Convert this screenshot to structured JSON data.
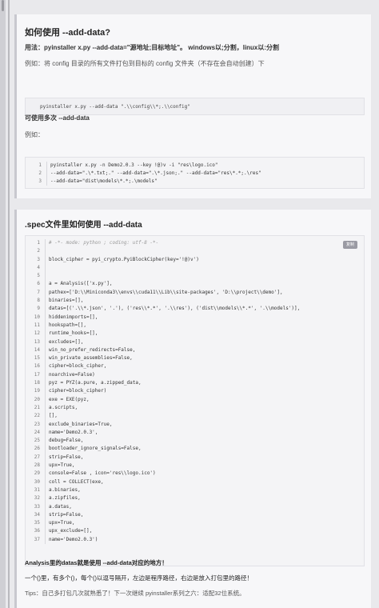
{
  "section1": {
    "title": "如何使用 --add-data?",
    "usage": "用法：pyinstaller x.py --add-data=\"源地址;目标地址\"。 windows以;分割，linux以:分割",
    "example_label": "例如：将 config 目录的所有文件打包到目标的 config 文件夹（不存在会自动创建）下",
    "single_code": "pyinstaller x.py --add-data \".\\\\config\\\\*;.\\\\config\"",
    "multi_label": "可使用多次 --add-data",
    "example2_label": "例如：",
    "code_lines": [
      {
        "n": "1",
        "t": "pyinstaller x.py  -n Demo2.0.3 --key !@)v -i \"res\\logo.ico\""
      },
      {
        "n": "2",
        "t": "--add-data=\".\\*.txt;.\" --add-data=\".\\*.json;.\" --add-data=\"res\\*.*;.\\res\""
      },
      {
        "n": "3",
        "t": "--add-data=\"dist\\models\\*.*;.\\models\""
      }
    ]
  },
  "section2": {
    "title": ".spec文件里如何使用 --add-data",
    "copy_label": "复制",
    "code_lines": [
      {
        "n": "1",
        "t": "# -*- mode: python ; coding: utf-8 -*-"
      },
      {
        "n": "2",
        "t": ""
      },
      {
        "n": "3",
        "t": "block_cipher = pyi_crypto.PyiBlockCipher(key='!@)v')"
      },
      {
        "n": "4",
        "t": ""
      },
      {
        "n": "5",
        "t": ""
      },
      {
        "n": "6",
        "t": "a = Analysis(['x.py'],"
      },
      {
        "n": "7",
        "t": "             pathex=['D:\\\\Miniconda3\\\\envs\\\\cuda11\\\\Lib\\\\site-packages', 'D:\\\\project\\\\demo'],"
      },
      {
        "n": "8",
        "t": "             binaries=[],"
      },
      {
        "n": "9",
        "t": "             datas=[('.\\\\*.json', '.'), ('res\\\\*.*', '.\\\\res'), ('dist\\\\models\\\\*.*', '.\\\\models')],"
      },
      {
        "n": "10",
        "t": "             hiddenimports=[],"
      },
      {
        "n": "11",
        "t": "             hookspath=[],"
      },
      {
        "n": "12",
        "t": "             runtime_hooks=[],"
      },
      {
        "n": "13",
        "t": "             excludes=[],"
      },
      {
        "n": "14",
        "t": "             win_no_prefer_redirects=False,"
      },
      {
        "n": "15",
        "t": "             win_private_assemblies=False,"
      },
      {
        "n": "16",
        "t": "             cipher=block_cipher,"
      },
      {
        "n": "17",
        "t": "             noarchive=False)"
      },
      {
        "n": "18",
        "t": "pyz = PYZ(a.pure, a.zipped_data,"
      },
      {
        "n": "19",
        "t": "             cipher=block_cipher)"
      },
      {
        "n": "20",
        "t": "exe = EXE(pyz,"
      },
      {
        "n": "21",
        "t": "          a.scripts,"
      },
      {
        "n": "22",
        "t": "          [],"
      },
      {
        "n": "23",
        "t": "          exclude_binaries=True,"
      },
      {
        "n": "24",
        "t": "          name='Demo2.0.3',"
      },
      {
        "n": "25",
        "t": "          debug=False,"
      },
      {
        "n": "26",
        "t": "          bootloader_ignore_signals=False,"
      },
      {
        "n": "27",
        "t": "          strip=False,"
      },
      {
        "n": "28",
        "t": "          upx=True,"
      },
      {
        "n": "29",
        "t": "          console=False , icon='res\\\\logo.ico')"
      },
      {
        "n": "30",
        "t": "coll = COLLECT(exe,"
      },
      {
        "n": "31",
        "t": "               a.binaries,"
      },
      {
        "n": "32",
        "t": "               a.zipfiles,"
      },
      {
        "n": "33",
        "t": "               a.datas,"
      },
      {
        "n": "34",
        "t": "               strip=False,"
      },
      {
        "n": "35",
        "t": "               upx=True,"
      },
      {
        "n": "36",
        "t": "               upx_exclude=[],"
      },
      {
        "n": "37",
        "t": "               name='Demo2.0.3')"
      }
    ],
    "note1": "Analysis里的datas就是使用 --add-data对应的地方！",
    "note2": "一个()里，有多个()，每个()以逗号隔开，左边是程序路径，右边是放入打包里的路径！",
    "tips": "Tips：自己多打包几次就熟悉了！下一次继续 pyinstaller系列之六：适配32位系统。"
  }
}
